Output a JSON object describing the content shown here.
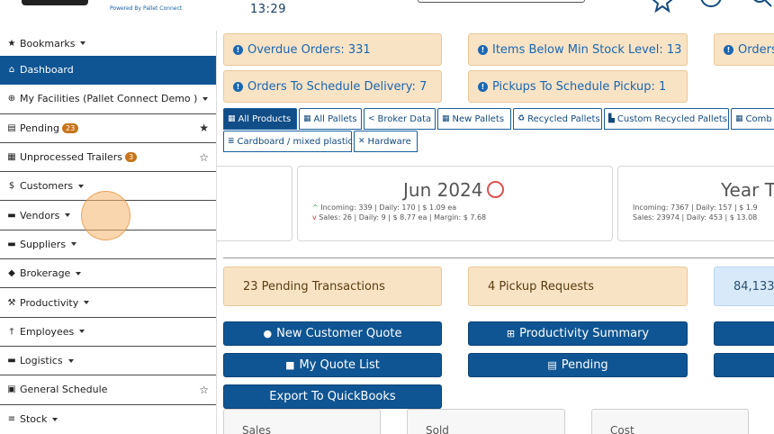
{
  "header": {
    "powered_by": "Powered By Pallet Connect",
    "clock": "13:29",
    "icons": [
      "star-icon",
      "clock-icon",
      "search-icon"
    ]
  },
  "sidebar": {
    "items": [
      {
        "label": "Bookmarks",
        "icon": "star-icon",
        "caret": true
      },
      {
        "label": "Dashboard",
        "icon": "home-icon",
        "active": true
      },
      {
        "label": "My Facilities (Pallet Connect Demo )",
        "icon": "globe-icon",
        "caret": true
      },
      {
        "label": "Pending",
        "icon": "clipboard-icon",
        "badge": "23",
        "star": "solid"
      },
      {
        "label": "Unprocessed Trailers",
        "icon": "trailer-icon",
        "badge": "3",
        "star": "outline"
      },
      {
        "label": "Customers",
        "icon": "dollar-icon",
        "caret": true
      },
      {
        "label": "Vendors",
        "icon": "truck-icon",
        "caret": true
      },
      {
        "label": "Suppliers",
        "icon": "truck-loading-icon",
        "caret": true
      },
      {
        "label": "Brokerage",
        "icon": "car-icon",
        "caret": true
      },
      {
        "label": "Productivity",
        "icon": "hammer-icon",
        "caret": true
      },
      {
        "label": "Employees",
        "icon": "person-icon",
        "caret": true
      },
      {
        "label": "Logistics",
        "icon": "truck-icon",
        "caret": true
      },
      {
        "label": "General Schedule",
        "icon": "calendar-icon",
        "star": "outline"
      },
      {
        "label": "Stock",
        "icon": "pallet-icon",
        "caret": true
      }
    ]
  },
  "alerts": {
    "overdue": "Overdue Orders: 331",
    "below_min": "Items Below Min Stock Level: 13",
    "orders_partial": "Orders",
    "to_schedule_delivery": "Orders To Schedule Delivery: 7",
    "pickups_to_schedule": "Pickups To Schedule Pickup: 1"
  },
  "tabs": [
    {
      "label": "All Products",
      "icon": "pallet-icon",
      "active": true
    },
    {
      "label": "All Pallets",
      "icon": "pallet-icon"
    },
    {
      "label": "Broker Data",
      "icon": "share-icon"
    },
    {
      "label": "New Pallets",
      "icon": "pallet-icon"
    },
    {
      "label": "Recycled Pallets",
      "icon": "recycle-icon"
    },
    {
      "label": "Custom Recycled Pallets",
      "icon": "chart-icon"
    },
    {
      "label": "Comb",
      "icon": "pallet-icon"
    },
    {
      "label": "Cardboard / mixed plastic",
      "icon": "list-icon"
    },
    {
      "label": "Hardware",
      "icon": "tools-icon"
    }
  ],
  "cards": {
    "month": {
      "title": "Jun 2024",
      "incoming": "Incoming: 339 | Daily: 170 | $ 1.09 ea",
      "sales": "Sales: 26 | Daily: 9 | $ 8.77 ea | Margin: $ 7.68"
    },
    "year": {
      "title": "Year T",
      "incoming": "Incoming: 7367 | Daily: 157 | $ 1.9",
      "sales": "Sales: 23974 | Daily: 453 | $ 13.08"
    }
  },
  "summary": {
    "pending_transactions": "23 Pending Transactions",
    "pickup_requests": "4 Pickup Requests",
    "partial_count": "84,133"
  },
  "buttons": {
    "new_customer_quote": "New Customer Quote",
    "productivity_summary": "Productivity Summary",
    "my_quote_list": "My Quote List",
    "pending": "Pending",
    "export_quickbooks": "Export To QuickBooks"
  },
  "stats": {
    "sales": "Sales",
    "sold": "Sold",
    "cost": "Cost"
  },
  "colors": {
    "primary": "#0f5593",
    "alert_bg": "#f8e3c5",
    "alert_text": "#1967b3",
    "badge": "#c8741a"
  }
}
